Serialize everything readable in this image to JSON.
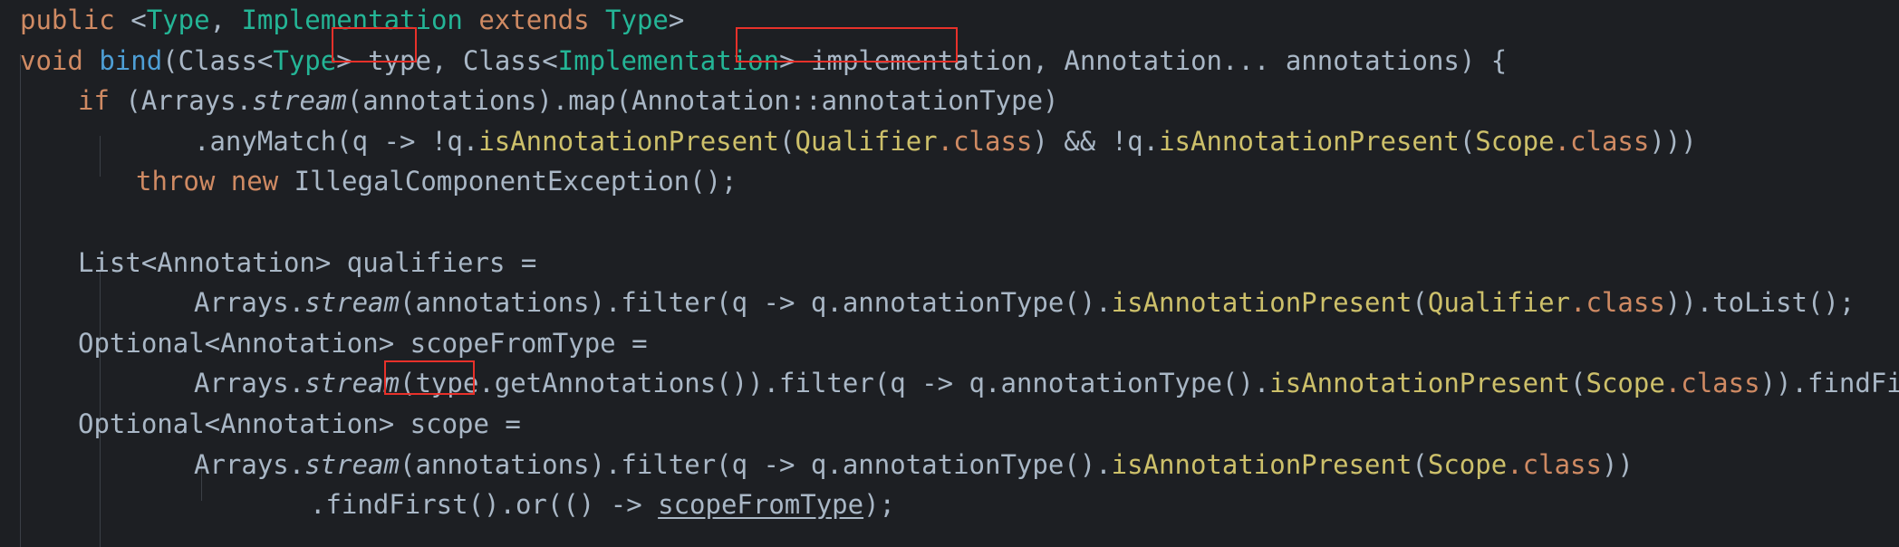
{
  "editor": {
    "theme": "dark",
    "background_color": "#1d1f23",
    "default_text_color": "#a9b7c6",
    "font": "monospace",
    "language": "Java"
  },
  "colors": {
    "keyword": "#cf8a63",
    "generic_type": "#24b596",
    "method_name_declaration": "#4e9fd6",
    "annotation_class": "#cdc06a",
    "dot_class": "#cf8a63",
    "identifier": "#a9b7c6",
    "annotation_box_border": "#e8312a",
    "indent_guide": "#3b3f46"
  },
  "code": {
    "lines": [
      {
        "id": "line-1",
        "text": "public <Type, Implementation extends Type>"
      },
      {
        "id": "line-2",
        "text": "void bind(Class<Type> type, Class<Implementation> implementation, Annotation... annotations) {"
      },
      {
        "id": "line-3",
        "text": "    if (Arrays.stream(annotations).map(Annotation::annotationType)"
      },
      {
        "id": "line-4",
        "text": "            .anyMatch(q -> !q.isAnnotationPresent(Qualifier.class) && !q.isAnnotationPresent(Scope.class)))"
      },
      {
        "id": "line-5",
        "text": "        throw new IllegalComponentException();"
      },
      {
        "id": "line-6",
        "text": ""
      },
      {
        "id": "line-7",
        "text": "    List<Annotation> qualifiers ="
      },
      {
        "id": "line-8",
        "text": "            Arrays.stream(annotations).filter(q -> q.annotationType().isAnnotationPresent(Qualifier.class)).toList();"
      },
      {
        "id": "line-9",
        "text": "    Optional<Annotation> scopeFromType ="
      },
      {
        "id": "line-10",
        "text": "            Arrays.stream(type.getAnnotations()).filter(q -> q.annotationType().isAnnotationPresent(Scope.class)).findFirst();"
      },
      {
        "id": "line-11",
        "text": "    Optional<Annotation> scope ="
      },
      {
        "id": "line-12",
        "text": "            Arrays.stream(annotations).filter(q -> q.annotationType().isAnnotationPresent(Scope.class))"
      },
      {
        "id": "line-13",
        "text": "                .findFirst().or(() -> scopeFromType);"
      }
    ]
  },
  "tokens": {
    "l1": {
      "public": "public",
      "lt": " <",
      "type1": "Type",
      "comma": ", ",
      "impl": "Implementation",
      "extends": " extends ",
      "type2": "Type",
      "gt": ">"
    },
    "l2": {
      "void": "void",
      "space": " ",
      "bind": "bind",
      "open": "(Class<",
      "type": "Type",
      "close": "> ",
      "param_type": "type",
      "comma": ", Class<",
      "impl_type": "Implementation",
      "gt": "> ",
      "param_impl": "implementation",
      "rest": ", Annotation... annotations) {"
    },
    "l3": {
      "if": "if",
      "open": " (Arrays.",
      "stream": "stream",
      "rest": "(annotations).map(Annotation::annotationType)"
    },
    "l4": {
      "anymatch": ".anyMatch(q -> !q.",
      "isap1": "isAnnotationPresent",
      "p1": "(",
      "qualifier": "Qualifier",
      "dotclass1": ".class",
      "mid": ") && !q.",
      "isap2": "isAnnotationPresent",
      "p2": "(",
      "scope": "Scope",
      "dotclass2": ".class",
      "end": ")))"
    },
    "l5": {
      "throw": "throw",
      "sp1": " ",
      "new": "new",
      "sp2": " ",
      "exception": "IllegalComponentException();"
    },
    "l7": {
      "text": "List<Annotation> qualifiers ="
    },
    "l8": {
      "arrays": "Arrays.",
      "stream": "stream",
      "mid": "(annotations).filter(q -> q.annotationType().",
      "isap": "isAnnotationPresent",
      "p": "(",
      "qualifier": "Qualifier",
      "dotclass": ".class",
      "end": ")).toList();"
    },
    "l9": {
      "text": "Optional<Annotation> scopeFromType ="
    },
    "l10": {
      "arrays": "Arrays.",
      "stream": "stream",
      "paren": "(",
      "type": "type",
      "dot": ".",
      "mid": "getAnnotations()).filter(q -> q.annotationType().",
      "isap": "isAnnotationPresent",
      "p": "(",
      "scope": "Scope",
      "dotclass": ".class",
      "end": ")).findFirst();"
    },
    "l11": {
      "text": "Optional<Annotation> scope ="
    },
    "l12": {
      "arrays": "Arrays.",
      "stream": "stream",
      "mid": "(annotations).filter(q -> q.annotationType().",
      "isap": "isAnnotationPresent",
      "p": "(",
      "scope": "Scope",
      "dotclass": ".class",
      "end": "))"
    },
    "l13": {
      "pre": ".findFirst().or(() -> ",
      "scopeFromType": "scopeFromType",
      "end": ");"
    }
  },
  "annotations": {
    "boxes": [
      {
        "id": "box-param-type",
        "label": "type",
        "line": 2
      },
      {
        "id": "box-param-implementation",
        "label": "implementation",
        "line": 2
      },
      {
        "id": "box-type-dot",
        "label": "type.",
        "line": 10
      }
    ]
  }
}
